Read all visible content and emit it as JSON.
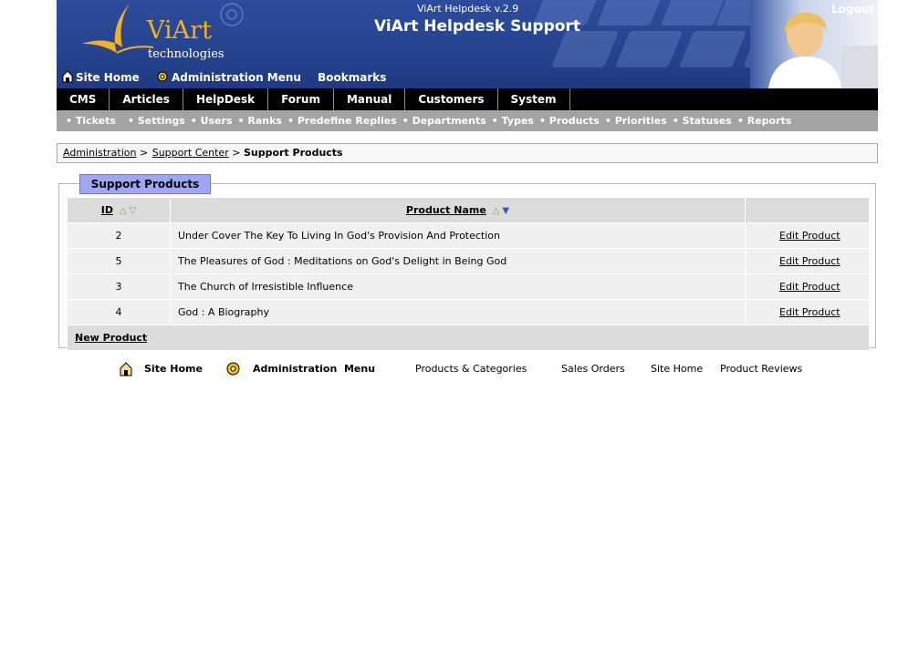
{
  "header": {
    "version": "ViArt Helpdesk v.2.9",
    "title": "ViArt Helpdesk Support",
    "logout": "Logout",
    "logo_main": "ViArt",
    "logo_sub": "technologies",
    "top_links": [
      "Site Home",
      "Administration Menu",
      "Bookmarks"
    ]
  },
  "main_menu": [
    "CMS",
    "Articles",
    "HelpDesk",
    "Forum",
    "Manual",
    "Customers",
    "System"
  ],
  "sub_menu": [
    "• Tickets",
    "• Settings",
    "• Users",
    "• Ranks",
    "• Predefine Replies",
    "• Departments",
    "• Types",
    "• Products",
    "• Priorities",
    "• Statuses",
    "• Reports"
  ],
  "breadcrumb": {
    "items": [
      "Administration",
      "Support Center"
    ],
    "separator": ">",
    "current": "Support Products"
  },
  "products": {
    "tab_title": "Support Products",
    "columns": {
      "id": "ID",
      "name": "Product Name"
    },
    "rows": [
      {
        "id": "2",
        "name": "Under Cover The Key To Living In God's Provision And Protection",
        "action": "Edit Product"
      },
      {
        "id": "5",
        "name": "The Pleasures of God : Meditations on God's Delight in Being God",
        "action": "Edit Product"
      },
      {
        "id": "3",
        "name": "The Church of Irresistible Influence",
        "action": "Edit Product"
      },
      {
        "id": "4",
        "name": "God : A Biography",
        "action": "Edit Product"
      }
    ],
    "new_link": "New Product"
  },
  "footer": {
    "site_home": "Site Home",
    "admin_menu": "Administration  Menu",
    "links": [
      "Products & Categories",
      "Sales Orders",
      "Site Home",
      "Product Reviews"
    ]
  },
  "colors": {
    "header_blue": "#26448f",
    "logo_gold": "#f2b320",
    "tab_purple": "#9fa7f2",
    "submenu_grey": "#a3a3a3"
  }
}
